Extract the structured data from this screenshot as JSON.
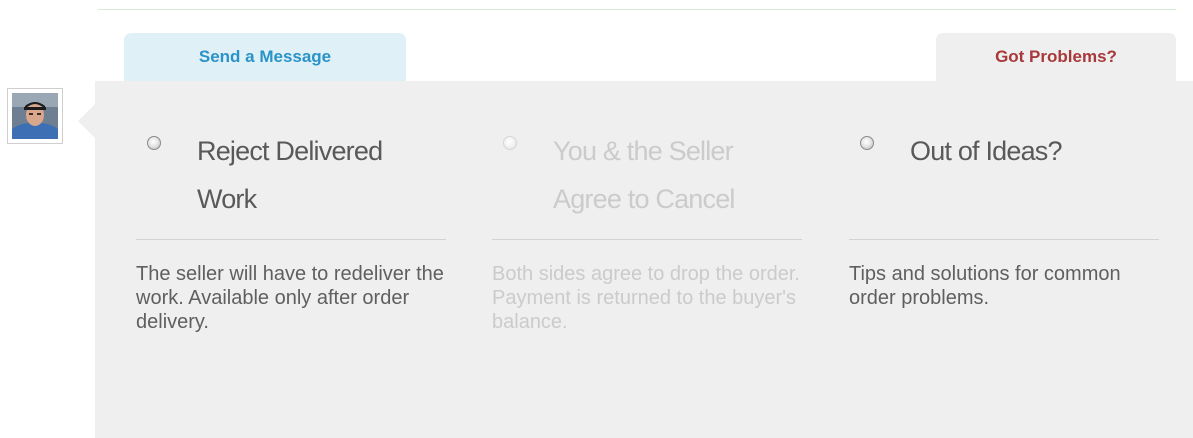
{
  "tabs": {
    "send_message": "Send a Message",
    "got_problems": "Got Problems?"
  },
  "options": [
    {
      "title": "Reject Delivered Work",
      "description": "The seller will have to redeliver the work. Available only after order delivery.",
      "enabled": true
    },
    {
      "title": "You & the Seller Agree to Cancel",
      "description": "Both sides agree to drop the order. Payment is returned to the buyer's balance.",
      "enabled": false
    },
    {
      "title": "Out of Ideas?",
      "description": "Tips and solutions for common order problems.",
      "enabled": true
    }
  ],
  "colors": {
    "send_tab_text": "#2a93c8",
    "send_tab_bg": "#e0f0f7",
    "problems_tab_text": "#a8393b",
    "panel_bg": "#efefef",
    "disabled_text": "#cbcbcb"
  }
}
